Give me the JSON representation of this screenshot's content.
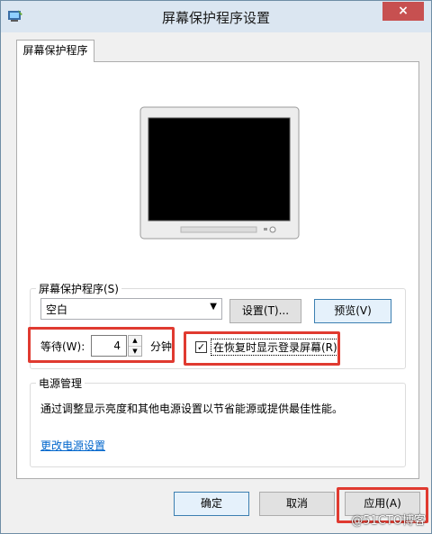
{
  "window": {
    "title": "屏幕保护程序设置",
    "close_label": "×"
  },
  "tab": {
    "label": "屏幕保护程序"
  },
  "screensaver": {
    "group_label": "屏幕保护程序(S)",
    "selected": "空白",
    "settings_button": "设置(T)...",
    "preview_button": "预览(V)",
    "wait_label": "等待(W):",
    "wait_value": "4",
    "wait_unit": "分钟",
    "resume_label": "在恢复时显示登录屏幕(R)",
    "resume_checked": true
  },
  "power": {
    "group_label": "电源管理",
    "description": "通过调整显示亮度和其他电源设置以节省能源或提供最佳性能。",
    "link": "更改电源设置"
  },
  "footer": {
    "ok": "确定",
    "cancel": "取消",
    "apply": "应用(A)"
  },
  "watermark": "@51CTO博客",
  "colors": {
    "highlight": "#e03a30",
    "link": "#0066cc",
    "close": "#c75050"
  }
}
